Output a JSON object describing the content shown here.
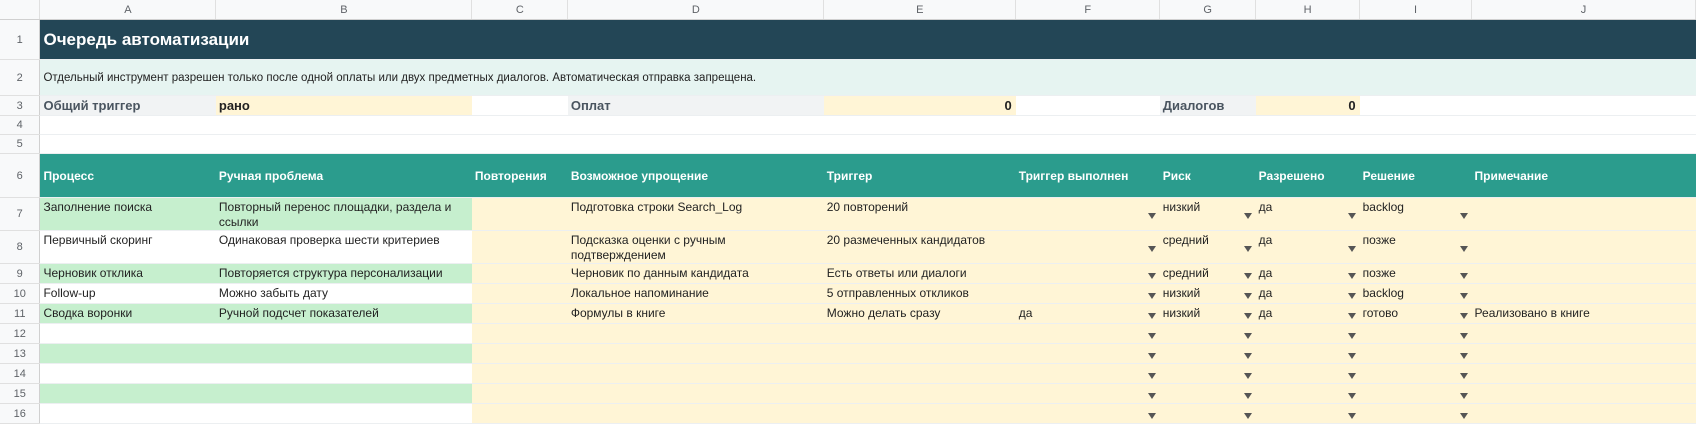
{
  "columns": [
    "A",
    "B",
    "C",
    "D",
    "E",
    "F",
    "G",
    "H",
    "I",
    "J"
  ],
  "row_numbers": [
    "1",
    "2",
    "3",
    "4",
    "5",
    "6",
    "7",
    "8",
    "9",
    "10",
    "11",
    "12",
    "13",
    "14",
    "15",
    "16"
  ],
  "title": "Очередь автоматизации",
  "note": "Отдельный инструмент разрешен только после одной оплаты или двух предметных диалогов. Автоматическая отправка запрещена.",
  "summary": {
    "trigger_label": "Общий триггер",
    "trigger_value": "рано",
    "payments_label": "Оплат",
    "payments_value": "0",
    "dialogs_label": "Диалогов",
    "dialogs_value": "0"
  },
  "headers": [
    "Процесс",
    "Ручная проблема",
    "Повторения",
    "Возможное упрощение",
    "Триггер",
    "Триггер выполнен",
    "Риск",
    "Разрешено",
    "Решение",
    "Примечание"
  ],
  "rows": [
    {
      "process": "Заполнение поиска",
      "problem": "Повторный перенос площадки, раздела и ссылки",
      "repeats": "",
      "simplify": "Подготовка строки Search_Log",
      "trigger": "20 повторений",
      "done": "",
      "risk": "низкий",
      "allowed": "да",
      "decision": "backlog",
      "note": ""
    },
    {
      "process": "Первичный скоринг",
      "problem": "Одинаковая проверка шести критериев",
      "repeats": "",
      "simplify": "Подсказка оценки с ручным подтверждением",
      "trigger": "20 размеченных кандидатов",
      "done": "",
      "risk": "средний",
      "allowed": "да",
      "decision": "позже",
      "note": ""
    },
    {
      "process": "Черновик отклика",
      "problem": "Повторяется структура персонализации",
      "repeats": "",
      "simplify": "Черновик по данным кандидата",
      "trigger": "Есть ответы или диалоги",
      "done": "",
      "risk": "средний",
      "allowed": "да",
      "decision": "позже",
      "note": ""
    },
    {
      "process": "Follow-up",
      "problem": "Можно забыть дату",
      "repeats": "",
      "simplify": "Локальное напоминание",
      "trigger": "5 отправленных откликов",
      "done": "",
      "risk": "низкий",
      "allowed": "да",
      "decision": "backlog",
      "note": ""
    },
    {
      "process": "Сводка воронки",
      "problem": "Ручной подсчет показателей",
      "repeats": "",
      "simplify": "Формулы в книге",
      "trigger": "Можно делать сразу",
      "done": "да",
      "risk": "низкий",
      "allowed": "да",
      "decision": "готово",
      "note": "Реализовано в книге"
    },
    {
      "process": "",
      "problem": "",
      "repeats": "",
      "simplify": "",
      "trigger": "",
      "done": "",
      "risk": "",
      "allowed": "",
      "decision": "",
      "note": ""
    },
    {
      "process": "",
      "problem": "",
      "repeats": "",
      "simplify": "",
      "trigger": "",
      "done": "",
      "risk": "",
      "allowed": "",
      "decision": "",
      "note": ""
    },
    {
      "process": "",
      "problem": "",
      "repeats": "",
      "simplify": "",
      "trigger": "",
      "done": "",
      "risk": "",
      "allowed": "",
      "decision": "",
      "note": ""
    },
    {
      "process": "",
      "problem": "",
      "repeats": "",
      "simplify": "",
      "trigger": "",
      "done": "",
      "risk": "",
      "allowed": "",
      "decision": "",
      "note": ""
    },
    {
      "process": "",
      "problem": "",
      "repeats": "",
      "simplify": "",
      "trigger": "",
      "done": "",
      "risk": "",
      "allowed": "",
      "decision": "",
      "note": ""
    }
  ]
}
